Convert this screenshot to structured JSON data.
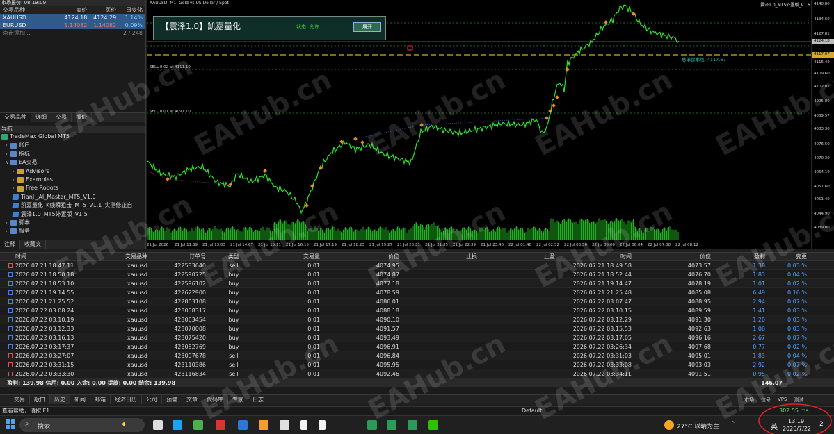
{
  "market_watch": {
    "title": "市场报价: 08:19:09",
    "headers": [
      "交易品种",
      "卖价",
      "买价",
      "日变化"
    ],
    "rows": [
      {
        "symbol": "XAUUSD",
        "bid": "4124.18",
        "ask": "4124.29",
        "change": "1.14%"
      },
      {
        "symbol": "EURUSD",
        "bid": "1.14082",
        "ask": "1.14082",
        "change": "0.09%"
      }
    ],
    "add_label": "点击添加...",
    "count": "2 / 248",
    "tabs": [
      "交易品种",
      "详细",
      "交易",
      "报价"
    ]
  },
  "navigator": {
    "title": "导航",
    "items": [
      {
        "label": "TradeMax Global MT5",
        "type": "root"
      },
      {
        "label": "账户",
        "type": "item"
      },
      {
        "label": "指标",
        "type": "item"
      },
      {
        "label": "EA交易",
        "type": "item"
      },
      {
        "label": "Advisors",
        "type": "folder"
      },
      {
        "label": "Examples",
        "type": "folder"
      },
      {
        "label": "Free Robots",
        "type": "folder"
      },
      {
        "label": "TianJi_AI_Master_MT5_V1.0",
        "type": "ea"
      },
      {
        "label": "凯嘉量化_K线瞬狙击_MT5_V1.1_实测修正自",
        "type": "ea"
      },
      {
        "label": "震泽1.0_MT5外置版_V1.5",
        "type": "ea"
      },
      {
        "label": "脚本",
        "type": "item"
      },
      {
        "label": "服务",
        "type": "item"
      }
    ],
    "tabs": [
      "注释",
      "收藏夹"
    ]
  },
  "chart": {
    "title": "XAUUSD, M1:  Gold vs US Dollar / Spot",
    "ea_name": "震泽1.0_MT5外置版_V1.5",
    "panel": {
      "name": "【震泽1.0】凯嘉量化",
      "status": "状态: 允许",
      "button": "展开"
    },
    "hlines": [
      "SELL 0.02 at 4111.10",
      "SELL 0.01 at 4091.10"
    ],
    "breakeven_label": "总单保本线: 4117.67",
    "price_labels": [
      "4140.80",
      "4134.60",
      "4127.81",
      "4124.18",
      "4117.67",
      "4115.40",
      "4109.60",
      "4102.01",
      "4095.80",
      "4089.57",
      "4083.30",
      "4076.50",
      "4070.30",
      "4064.10",
      "4057.60",
      "4051.40",
      "4044.90",
      "4039.00"
    ],
    "time_labels": [
      "21 Jul 2026",
      "21 Jul 11:59",
      "21 Jul 13:03",
      "21 Jul 14:07",
      "21 Jul 15:11",
      "21 Jul 16:15",
      "21 Jul 17:19",
      "21 Jul 18:23",
      "21 Jul 19:27",
      "21 Jul 20:31",
      "21 Jul 21:35",
      "21 Jul 22:39",
      "21 Jul 23:40",
      "22 Jul 01:48",
      "22 Jul 02:52",
      "22 Jul 03:56",
      "22 Jul 05:00",
      "22 Jul 06:04",
      "22 Jul 07:08",
      "22 Jul 08:12"
    ]
  },
  "trades": {
    "headers": [
      "时间",
      "交易品种",
      "订单号",
      "类型",
      "交易量",
      "价位",
      "止损",
      "止盈",
      "时间",
      "价位",
      "盈利",
      "变更"
    ],
    "rows": [
      [
        "2026.07.21 18:47:11",
        "xauusd",
        "422583640",
        "sell",
        "0.01",
        "4074.95",
        "",
        "",
        "2026.07.21 18:49:58",
        "4073.57",
        "1.38",
        "0.03 %"
      ],
      [
        "2026.07.21 18:50:18",
        "xauusd",
        "422590725",
        "buy",
        "0.01",
        "4074.87",
        "",
        "",
        "2026.07.21 18:52:44",
        "4076.70",
        "1.83",
        "0.04 %"
      ],
      [
        "2026.07.21 18:53:10",
        "xauusd",
        "422596102",
        "buy",
        "0.01",
        "4077.18",
        "",
        "",
        "2026.07.21 19:14:47",
        "4078.19",
        "1.01",
        "0.02 %"
      ],
      [
        "2026.07.21 19:14:55",
        "xauusd",
        "422622900",
        "buy",
        "0.01",
        "4078.59",
        "",
        "",
        "2026.07.21 21:25:48",
        "4085.08",
        "6.49",
        "0.16 %"
      ],
      [
        "2026.07.21 21:25:52",
        "xauusd",
        "422803108",
        "buy",
        "0.01",
        "4086.01",
        "",
        "",
        "2026.07.22 03:07:47",
        "4088.95",
        "2.94",
        "0.07 %"
      ],
      [
        "2026.07.22 03:08:24",
        "xauusd",
        "423058317",
        "buy",
        "0.01",
        "4088.18",
        "",
        "",
        "2026.07.22 03:10:15",
        "4089.59",
        "1.41",
        "0.03 %"
      ],
      [
        "2026.07.22 03:10:19",
        "xauusd",
        "423063454",
        "buy",
        "0.01",
        "4090.10",
        "",
        "",
        "2026.07.22 03:12:29",
        "4091.30",
        "1.20",
        "0.03 %"
      ],
      [
        "2026.07.22 03:12:33",
        "xauusd",
        "423070008",
        "buy",
        "0.01",
        "4091.57",
        "",
        "",
        "2026.07.22 03:15:53",
        "4092.63",
        "1.06",
        "0.03 %"
      ],
      [
        "2026.07.22 03:16:13",
        "xauusd",
        "423075420",
        "buy",
        "0.01",
        "4093.49",
        "",
        "",
        "2026.07.22 03:17:05",
        "4096.16",
        "2.67",
        "0.07 %"
      ],
      [
        "2026.07.22 03:17:37",
        "xauusd",
        "423082769",
        "buy",
        "0.01",
        "4096.91",
        "",
        "",
        "2026.07.22 03:26:34",
        "4097.68",
        "0.77",
        "0.02 %"
      ],
      [
        "2026.07.22 03:27:07",
        "xauusd",
        "423097678",
        "sell",
        "0.01",
        "4096.84",
        "",
        "",
        "2026.07.22 03:31:03",
        "4095.01",
        "1.83",
        "0.04 %"
      ],
      [
        "2026.07.22 03:31:15",
        "xauusd",
        "423110386",
        "sell",
        "0.01",
        "4095.95",
        "",
        "",
        "2026.07.22 03:33:08",
        "4093.03",
        "2.92",
        "0.07 %"
      ],
      [
        "2026.07.22 03:33:30",
        "xauusd",
        "423116834",
        "sell",
        "0.01",
        "4092.46",
        "",
        "",
        "2026.07.22 03:34:11",
        "4091.51",
        "0.95",
        "0.02 %"
      ]
    ],
    "total_label": "盈利: 139.98  信用: 0.00  入金: 0.00  提款: 0.00  结余: 139.98",
    "total_profit": "146.07"
  },
  "bottom_tabs": [
    "交易",
    "敞口",
    "历史",
    "新闻",
    "邮箱",
    "经济日历",
    "公司",
    "预警",
    "文章",
    "代码库",
    "专家",
    "日志"
  ],
  "bottom_right": [
    "市场",
    "信号",
    "VPS",
    "测试"
  ],
  "status": {
    "help": "查看帮助，请按 F1",
    "profile": "Default",
    "ping": "302.55 ms"
  },
  "taskbar": {
    "search": "搜索",
    "weather": "27°C  以晴为主",
    "lang": "英",
    "time": "13:19",
    "date": "2026/7/22",
    "notif": "2"
  },
  "watermark": "EAHub.cn"
}
